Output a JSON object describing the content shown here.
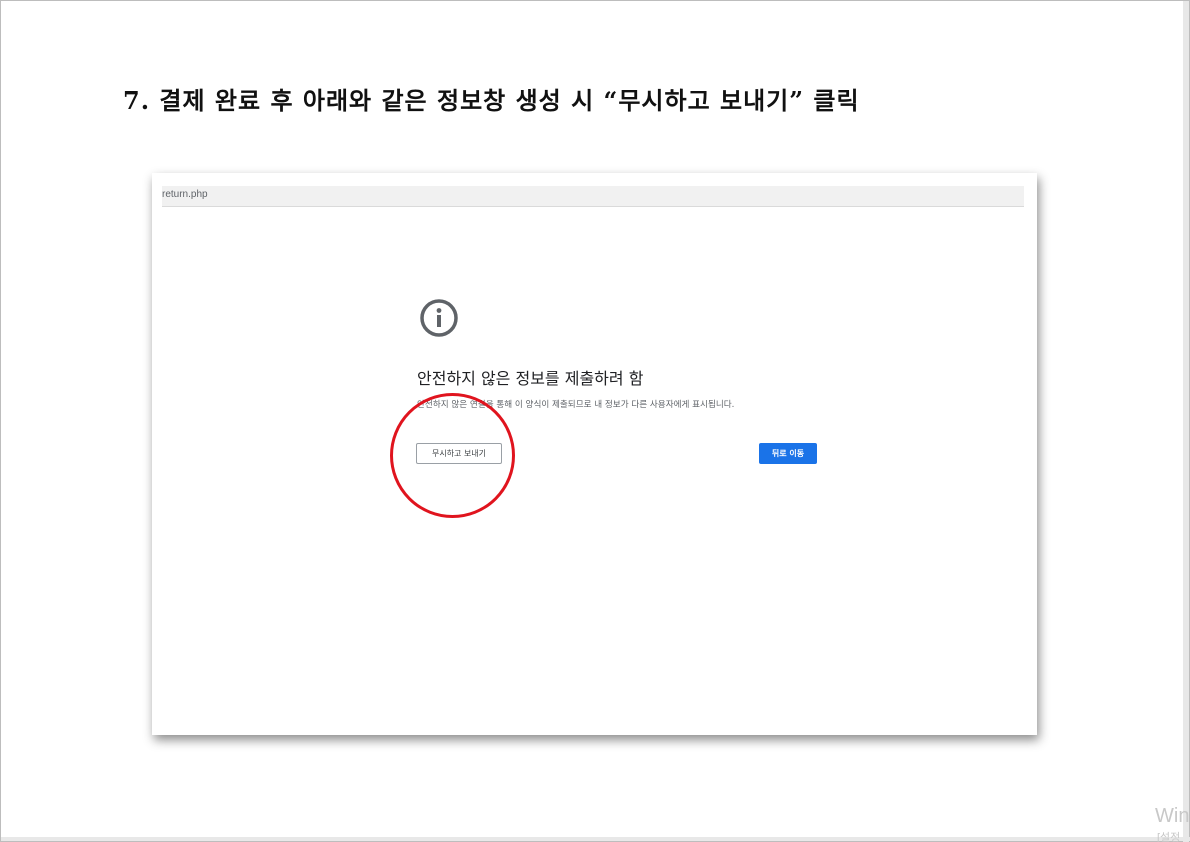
{
  "document": {
    "heading": "7. 결제 완료 후 아래와 같은 정보창 생성 시 “무시하고 보내기” 클릭"
  },
  "screenshot": {
    "address": "return.php",
    "icon": "info-icon",
    "title": "안전하지 않은 정보를 제출하려 함",
    "description": "안전하지 않은 연결을 통해 이 양식이 제출되므로 내 정보가 다른 사용자에게 표시됩니다.",
    "ignore_button": "무시하고 보내기",
    "back_button": "뒤로 이동",
    "highlight_color": "#e0141e",
    "primary_color": "#1a73e8"
  },
  "os_watermark": {
    "line1": "Win",
    "line2": "[설정"
  }
}
